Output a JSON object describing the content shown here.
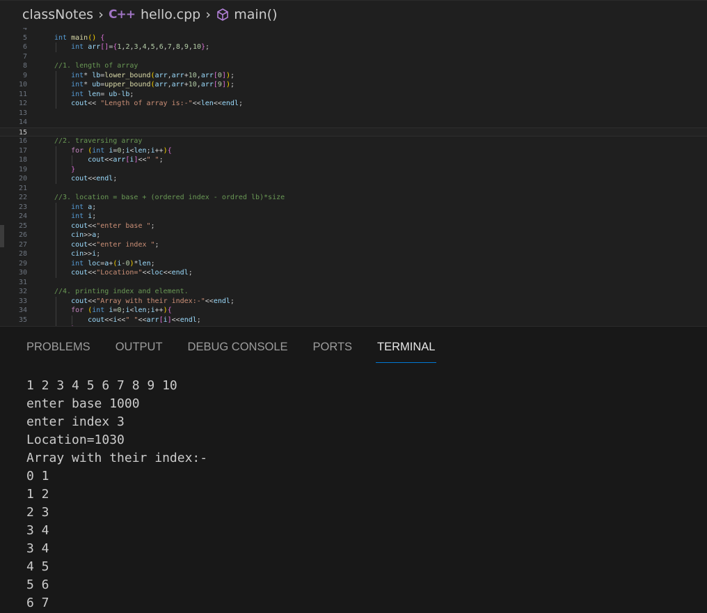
{
  "breadcrumb": {
    "folder": "classNotes",
    "file_icon": "C++",
    "file": "hello.cpp",
    "symbol": "main()"
  },
  "editor": {
    "current_line": 15,
    "lines": [
      {
        "n": "4",
        "t": ""
      },
      {
        "n": "5",
        "t": "int main() {"
      },
      {
        "n": "6",
        "t": "    int arr[]={1,2,3,4,5,6,7,8,9,10};"
      },
      {
        "n": "7",
        "t": ""
      },
      {
        "n": "8",
        "t": "//1. length of array"
      },
      {
        "n": "9",
        "t": "    int* lb=lower_bound(arr,arr+10,arr[0]);"
      },
      {
        "n": "10",
        "t": "    int* ub=upper_bound(arr,arr+10,arr[9]);"
      },
      {
        "n": "11",
        "t": "    int len= ub-lb;"
      },
      {
        "n": "12",
        "t": "    cout<< \"Length of array is:-\"<<len<<endl;"
      },
      {
        "n": "13",
        "t": ""
      },
      {
        "n": "14",
        "t": ""
      },
      {
        "n": "15",
        "t": ""
      },
      {
        "n": "16",
        "t": "//2. traversing array"
      },
      {
        "n": "17",
        "t": "    for (int i=0;i<len;i++){"
      },
      {
        "n": "18",
        "t": "        cout<<arr[i]<<\" \";"
      },
      {
        "n": "19",
        "t": "    }"
      },
      {
        "n": "20",
        "t": "    cout<<endl;"
      },
      {
        "n": "21",
        "t": ""
      },
      {
        "n": "22",
        "t": "//3. location = base + (ordered index - ordred lb)*size"
      },
      {
        "n": "23",
        "t": "    int a;"
      },
      {
        "n": "24",
        "t": "    int i;"
      },
      {
        "n": "25",
        "t": "    cout<<\"enter base \";"
      },
      {
        "n": "26",
        "t": "    cin>>a;"
      },
      {
        "n": "27",
        "t": "    cout<<\"enter index \";"
      },
      {
        "n": "28",
        "t": "    cin>>i;"
      },
      {
        "n": "29",
        "t": "    int loc=a+(i-0)*len;"
      },
      {
        "n": "30",
        "t": "    cout<<\"Location=\"<<loc<<endl;"
      },
      {
        "n": "31",
        "t": ""
      },
      {
        "n": "32",
        "t": "//4. printing index and element."
      },
      {
        "n": "33",
        "t": "    cout<<\"Array with their index:-\"<<endl;"
      },
      {
        "n": "34",
        "t": "    for (int i=0;i<len;i++){"
      },
      {
        "n": "35",
        "t": "        cout<<i<<\" \"<<arr[i]<<endl;"
      },
      {
        "n": "",
        "t": "    }"
      }
    ]
  },
  "panel": {
    "tabs": [
      "PROBLEMS",
      "OUTPUT",
      "DEBUG CONSOLE",
      "PORTS",
      "TERMINAL"
    ],
    "active_tab": "TERMINAL",
    "terminal_lines": [
      "1 2 3 4 5 6 7 8 9 10",
      "enter base 1000",
      "enter index 3",
      "Location=1030",
      "Array with their index:-",
      "0 1",
      "1 2",
      "2 3",
      "3 4",
      "3 4",
      "4 5",
      "5 6",
      "6 7"
    ]
  }
}
